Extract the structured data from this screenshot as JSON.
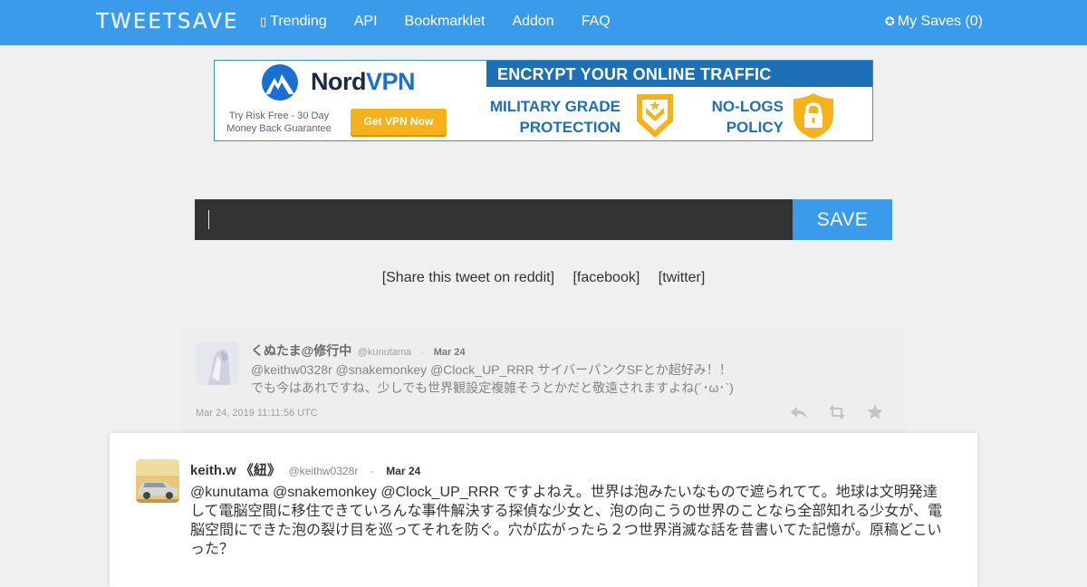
{
  "navbar": {
    "brand": "TWEETSAVE",
    "links": [
      {
        "label": "Trending",
        "icon": "fire-icon"
      },
      {
        "label": "API"
      },
      {
        "label": "Bookmarklet"
      },
      {
        "label": "Addon"
      },
      {
        "label": "FAQ"
      }
    ],
    "my_saves": {
      "label": "My Saves (0)",
      "icon": "plus-circle-icon"
    },
    "color": "#3a9bea"
  },
  "banner": {
    "brand_first": "Nord",
    "brand_second": "VPN",
    "try_line1": "Try Risk Free - 30 Day",
    "try_line2": "Money Back Guarantee",
    "cta": "Get VPN Now",
    "headline": "ENCRYPT YOUR ONLINE TRAFFIC",
    "feature1_line1": "MILITARY GRADE",
    "feature1_line2": "PROTECTION",
    "feature2_line1": "NO-LOGS",
    "feature2_line2": "POLICY"
  },
  "form": {
    "url_value": "",
    "save_label": "SAVE"
  },
  "share": {
    "reddit": "[Share this tweet on reddit]",
    "facebook": "[facebook]",
    "twitter": "[twitter]"
  },
  "parent_tweet": {
    "name": "くぬたま@修行中",
    "handle": "@kunutama",
    "separator": "·",
    "date": "Mar 24",
    "text_line1": "@keithw0328r @snakemonkey @Clock_UP_RRR サイバーパンクSFとか超好み！！",
    "text_line2": "でも今はあれですね、少しでも世界観設定複雑そうとかだと敬遠されますよね(´･ω･`)",
    "timestamp": "Mar 24, 2019 11:11:56 UTC",
    "actions": [
      "reply-icon",
      "retweet-icon",
      "favorite-icon"
    ]
  },
  "main_tweet": {
    "name": "keith.w 《紐》",
    "handle": "@keithw0328r",
    "separator": "·",
    "date": "Mar 24",
    "text": "@kunutama @snakemonkey @Clock_UP_RRR ですよねえ。世界は泡みたいなもので遮られてて。地球は文明発達して電脳空間に移住できていろんな事件解決する探偵な少女と、泡の向こうの世界のことなら全部知れる少女が、電脳空間にできた泡の裂け目を巡ってそれを防ぐ。穴が広がったら２つ世界消滅な話を昔書いてた記憶が。原稿どこいった？"
  }
}
